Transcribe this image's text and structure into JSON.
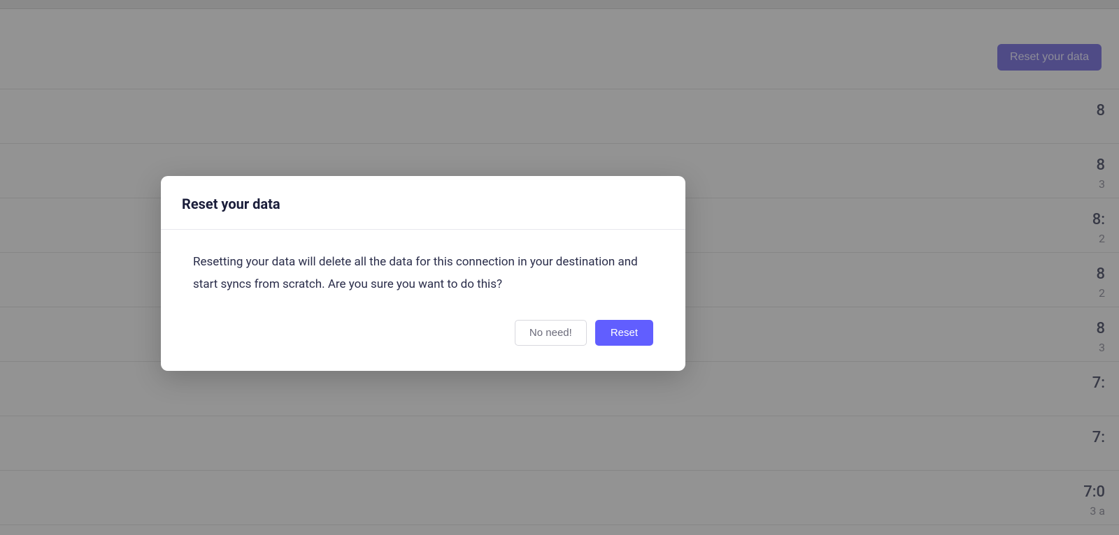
{
  "header": {
    "reset_button_label": "Reset your data"
  },
  "rows": [
    {
      "time": "8",
      "sub": ""
    },
    {
      "time": "8",
      "sub": "3"
    },
    {
      "time": "8:",
      "sub": "2"
    },
    {
      "time": "8",
      "sub": "2"
    },
    {
      "time": "8",
      "sub": "3"
    },
    {
      "time": "7:",
      "sub": ""
    },
    {
      "time": "7:",
      "sub": ""
    },
    {
      "time": "7:0",
      "sub": "3 a"
    }
  ],
  "modal": {
    "title": "Reset your data",
    "body": "Resetting your data will delete all the data for this connection in your destination and start syncs from scratch. Are you sure you want to do this?",
    "cancel_label": "No need!",
    "confirm_label": "Reset"
  }
}
